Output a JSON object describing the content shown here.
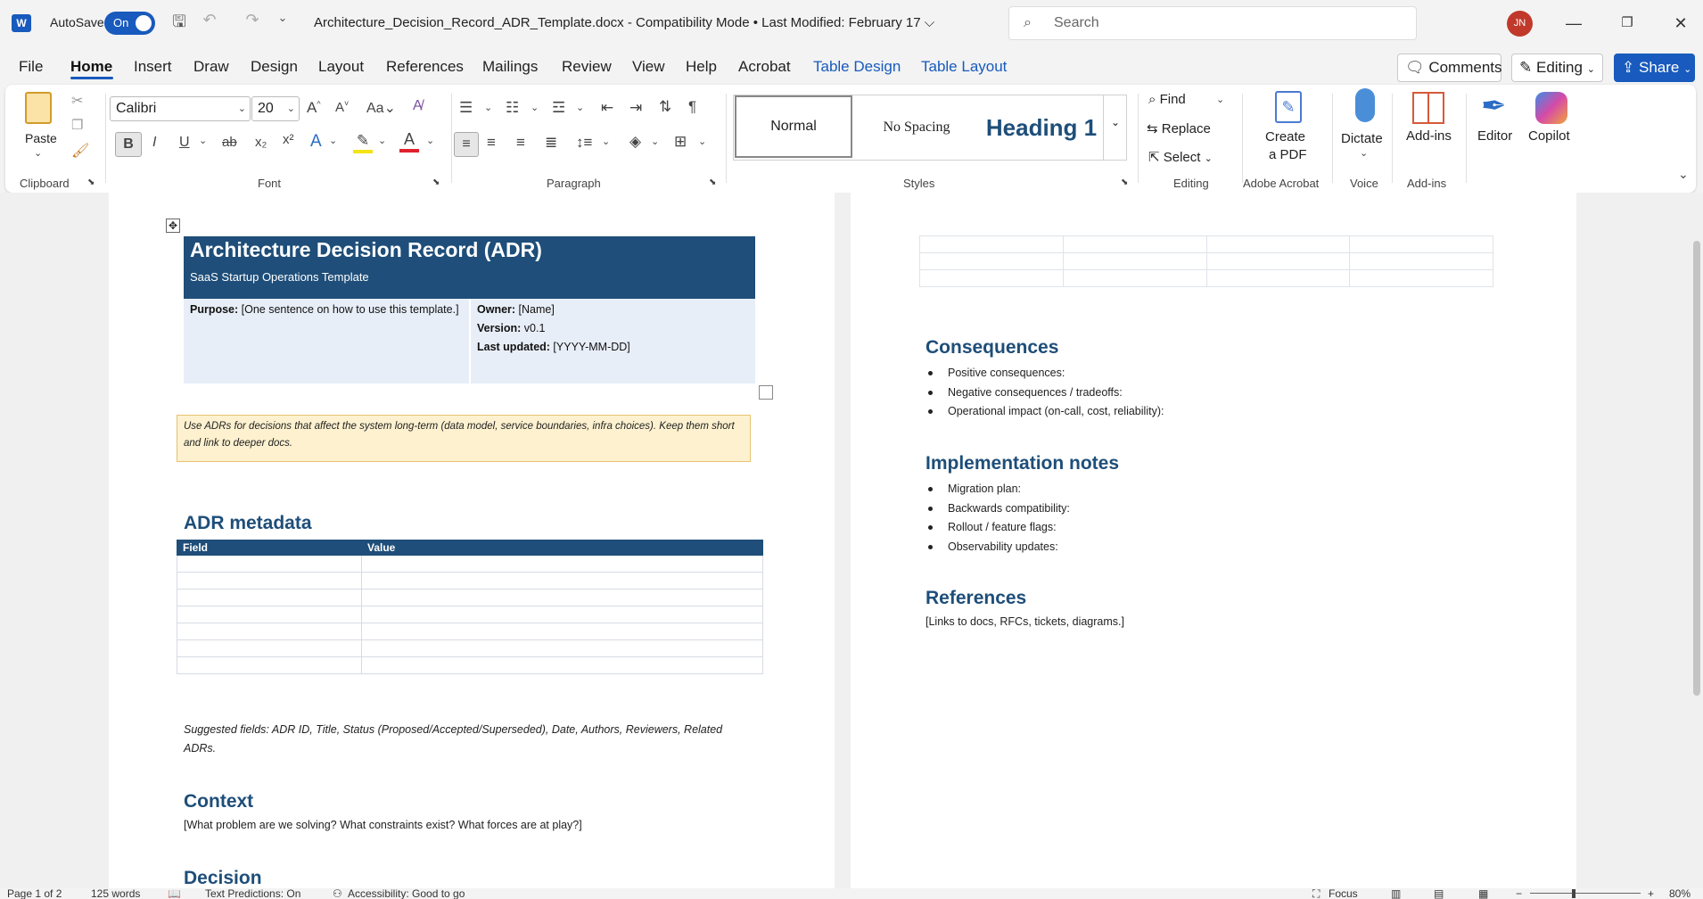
{
  "titlebar": {
    "app_icon": "W",
    "autosave_label": "AutoSave",
    "autosave_state": "On",
    "document_title": "Architecture_Decision_Record_ADR_Template.docx  -  Compatibility Mode  •  Last Modified: February 17 ⌵",
    "search_placeholder": "Search",
    "user_initials": "JN"
  },
  "menu": {
    "tabs": [
      "File",
      "Home",
      "Insert",
      "Draw",
      "Design",
      "Layout",
      "References",
      "Mailings",
      "Review",
      "View",
      "Help",
      "Acrobat",
      "Table Design",
      "Table Layout"
    ],
    "comments_label": "Comments",
    "editing_label": "Editing",
    "share_label": "Share"
  },
  "ribbon": {
    "clipboard": {
      "paste_label": "Paste",
      "group_label": "Clipboard"
    },
    "font": {
      "font_name": "Calibri",
      "font_size": "20",
      "group_label": "Font"
    },
    "paragraph": {
      "group_label": "Paragraph"
    },
    "styles": {
      "items": [
        "Normal",
        "No Spacing",
        "Heading 1"
      ],
      "group_label": "Styles"
    },
    "editing": {
      "find_label": "Find",
      "replace_label": "Replace",
      "select_label": "Select",
      "group_label": "Editing"
    },
    "acrobat": {
      "create_pdf_label_1": "Create",
      "create_pdf_label_2": "a PDF",
      "group_label": "Adobe Acrobat"
    },
    "voice": {
      "dictate_label": "Dictate",
      "group_label": "Voice"
    },
    "addins": {
      "addins_label": "Add-ins",
      "group_label": "Add-ins"
    },
    "editor_label": "Editor",
    "copilot_label": "Copilot"
  },
  "document": {
    "page1": {
      "title": "Architecture Decision Record (ADR)",
      "subtitle": "SaaS Startup Operations Template",
      "purpose_label": "Purpose:",
      "purpose_text": " [One sentence on how to use this template.]",
      "owner_label": "Owner:",
      "owner_text": " [Name]",
      "version_label": "Version:",
      "version_text": " v0.1",
      "updated_label": "Last updated:",
      "updated_text": " [YYYY-MM-DD]",
      "callout": "Use ADRs for decisions that affect the system long-term (data model, service boundaries, infra choices). Keep them short and link to deeper docs.",
      "metadata_heading": "ADR metadata",
      "metadata_columns": [
        "Field",
        "Value"
      ],
      "suggested_fields": "Suggested fields: ADR ID, Title, Status (Proposed/Accepted/Superseded), Date, Authors, Reviewers, Related ADRs.",
      "context_heading": "Context",
      "context_text": "[What problem are we solving? What constraints exist? What forces are at play?]",
      "decision_heading": "Decision"
    },
    "page2": {
      "consequences_heading": "Consequences",
      "consequences_items": [
        "Positive consequences:",
        "Negative consequences / tradeoffs:",
        "Operational impact (on-call, cost, reliability):"
      ],
      "implementation_heading": "Implementation notes",
      "implementation_items": [
        "Migration plan:",
        "Backwards compatibility:",
        "Rollout / feature flags:",
        "Observability updates:"
      ],
      "references_heading": "References",
      "references_text": "[Links to docs, RFCs, tickets, diagrams.]"
    }
  },
  "status": {
    "page": "Page 1 of 2",
    "words": "125 words",
    "text_predictions": "Text Predictions: On",
    "accessibility": "Accessibility: Good to go",
    "focus": "Focus",
    "zoom": "80%"
  }
}
